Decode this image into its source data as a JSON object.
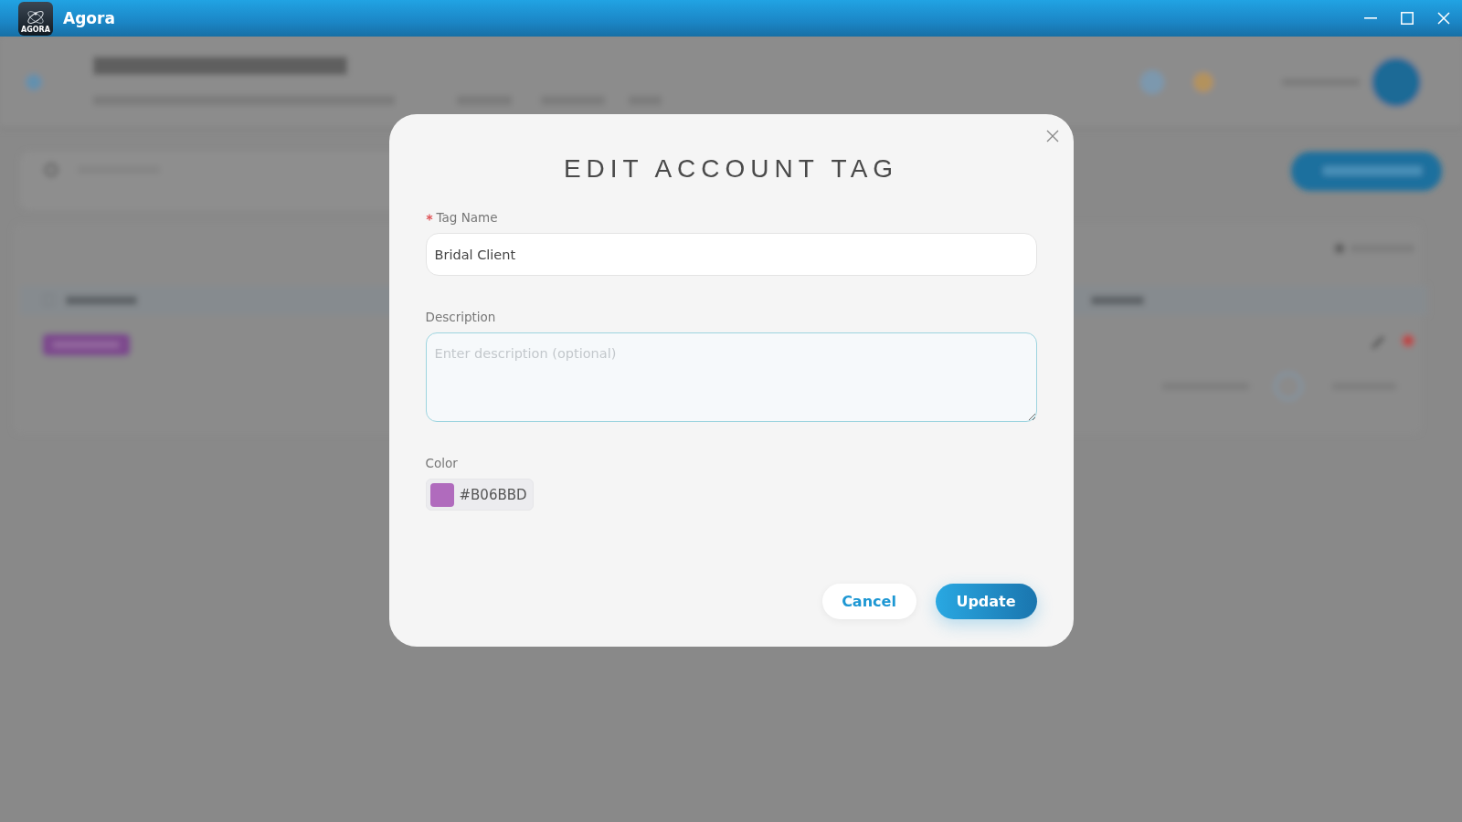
{
  "window": {
    "logo_text": "AGORA",
    "title": "Agora"
  },
  "dialog": {
    "title": "EDIT ACCOUNT TAG",
    "fields": [
      {
        "kind": "text",
        "label": "Tag Name",
        "required": true,
        "focused": false,
        "value": "Bridal Client"
      },
      {
        "kind": "textarea",
        "label": "Description",
        "required": false,
        "focused": true,
        "placeholder": "Enter description (optional)"
      },
      {
        "kind": "color",
        "label": "Color",
        "required": false,
        "focused": false,
        "value": "#B06BBD",
        "color": "#b06bbd"
      }
    ],
    "buttons": [
      {
        "kind": "cancel",
        "label": "Cancel"
      },
      {
        "kind": "submit",
        "label": "Update"
      }
    ]
  }
}
